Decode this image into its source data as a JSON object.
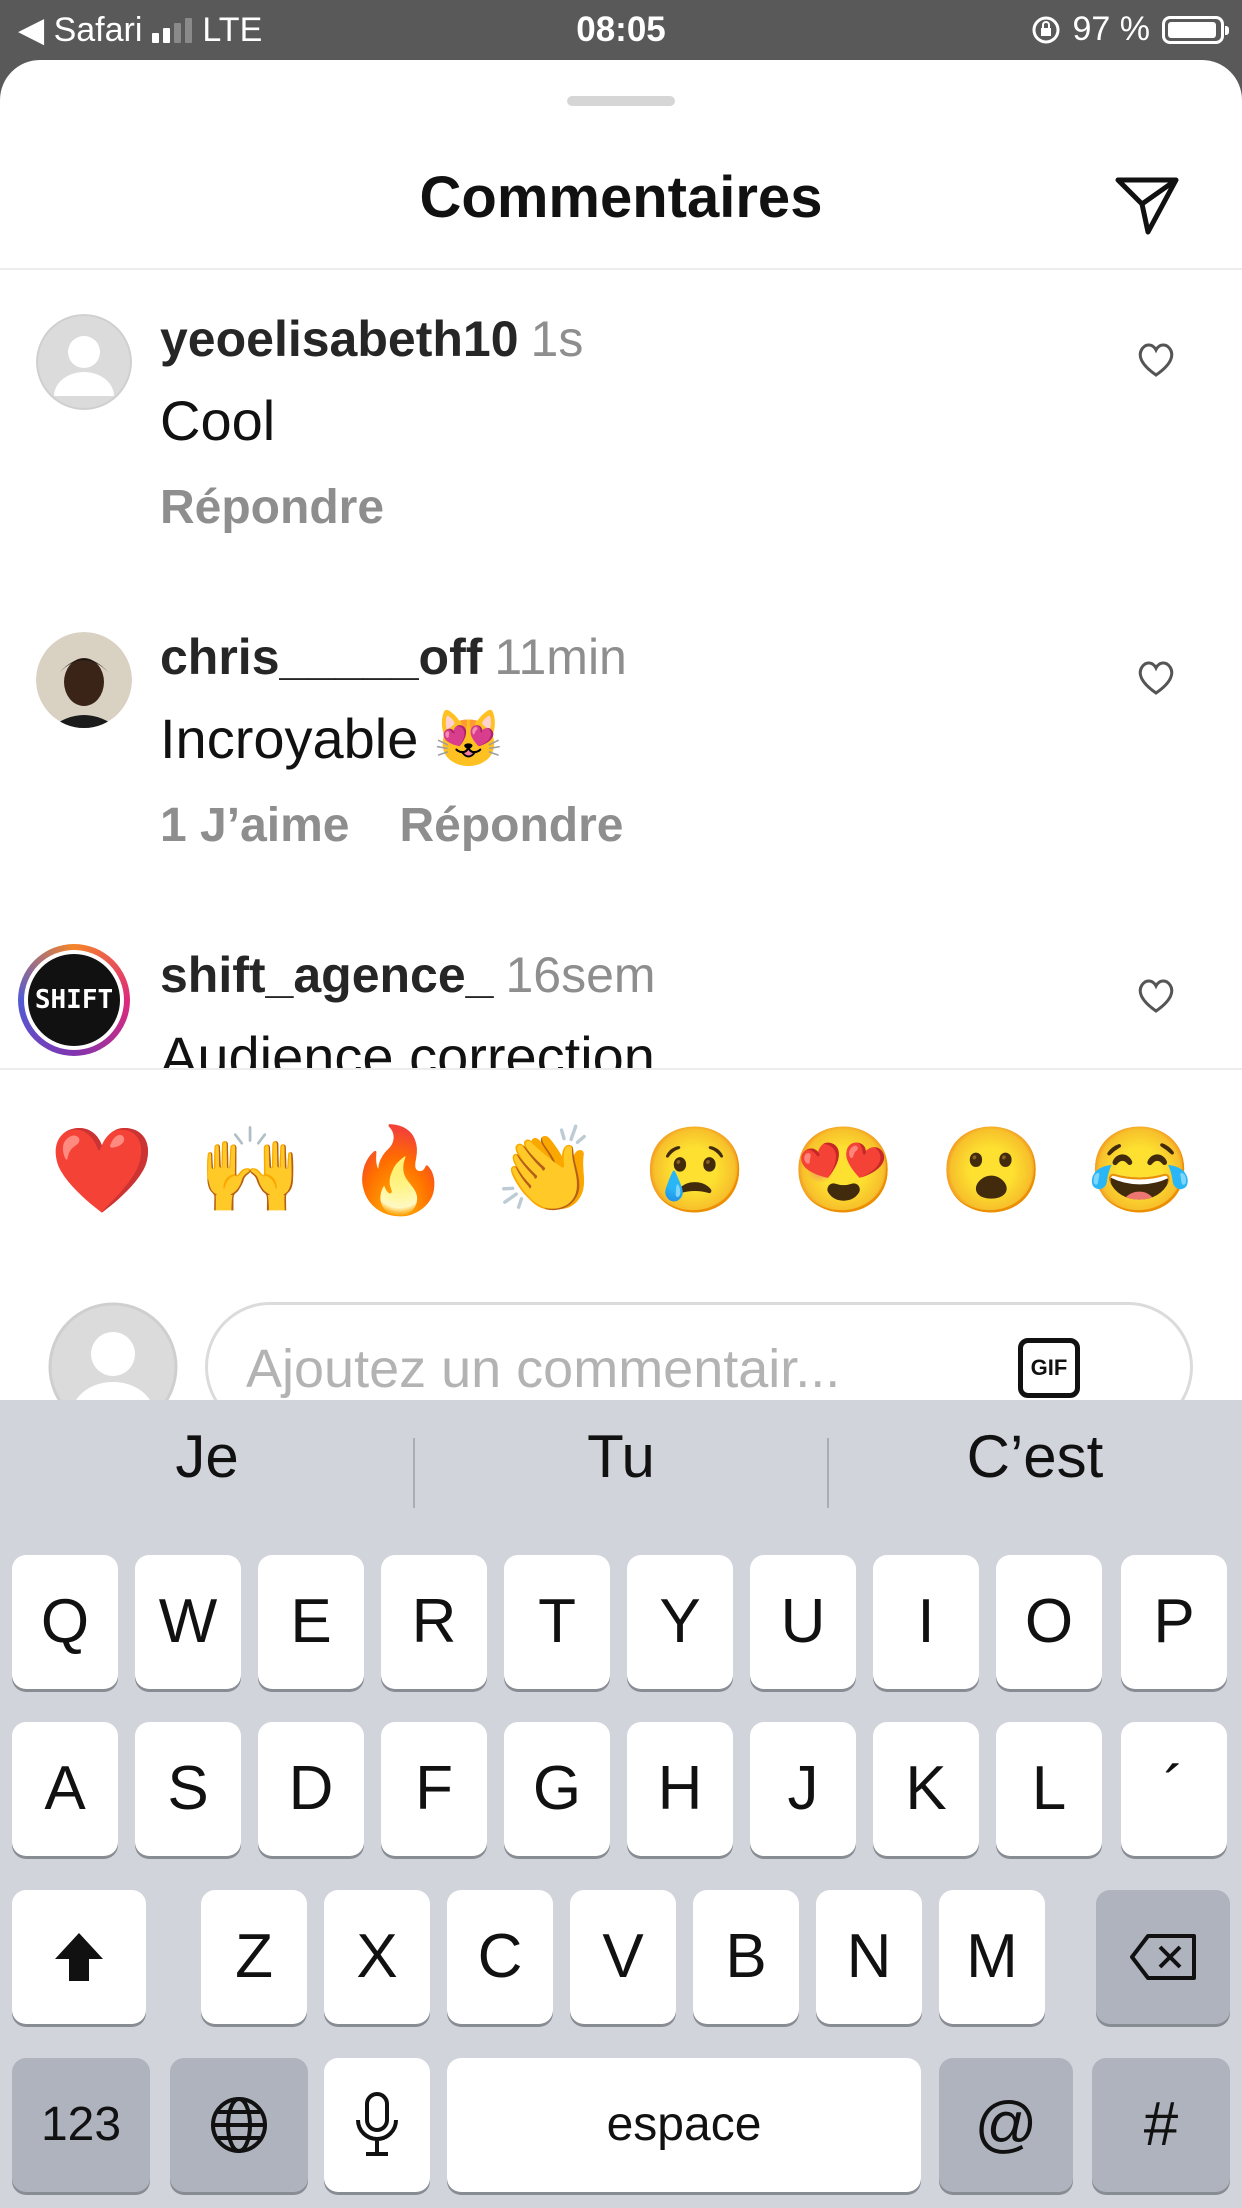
{
  "status_bar": {
    "back_app": "◀ Safari",
    "network": "LTE",
    "time": "08:05",
    "battery": "97 %"
  },
  "sheet": {
    "title": "Commentaires",
    "comments": [
      {
        "username": "yeoelisabeth10",
        "time": "1s",
        "text": "Cool",
        "likes": "",
        "reply": "Répondre",
        "avatar": "default"
      },
      {
        "username": "chris_____off",
        "time": "11min",
        "text": "Incroyable 😻",
        "likes": "1 J’aime",
        "reply": "Répondre",
        "avatar": "photo"
      },
      {
        "username": "shift_agence_",
        "time": "16sem",
        "text": "Audience correction",
        "likes": "",
        "reply": "",
        "avatar": "SHIFT"
      }
    ],
    "quick_emojis": [
      "❤️",
      "🙌",
      "🔥",
      "👏",
      "😢",
      "😍",
      "😮",
      "😂"
    ],
    "comment_input": {
      "placeholder": "Ajoutez un commentair...",
      "value": "",
      "gif_label": "GIF"
    }
  },
  "keyboard": {
    "predictions": [
      "Je",
      "Tu",
      "C’est"
    ],
    "row1": [
      "Q",
      "W",
      "E",
      "R",
      "T",
      "Y",
      "U",
      "I",
      "O",
      "P"
    ],
    "row2": [
      "A",
      "S",
      "D",
      "F",
      "G",
      "H",
      "J",
      "K",
      "L",
      "´"
    ],
    "row3": [
      "Z",
      "X",
      "C",
      "V",
      "B",
      "N",
      "M"
    ],
    "numbers_key": "123",
    "space_key": "espace",
    "at_key": "@",
    "hash_key": "#"
  },
  "colors": {
    "accent_text": "#262626",
    "muted_text": "#8e8e8e",
    "keyboard_bg": "#d1d4db"
  }
}
